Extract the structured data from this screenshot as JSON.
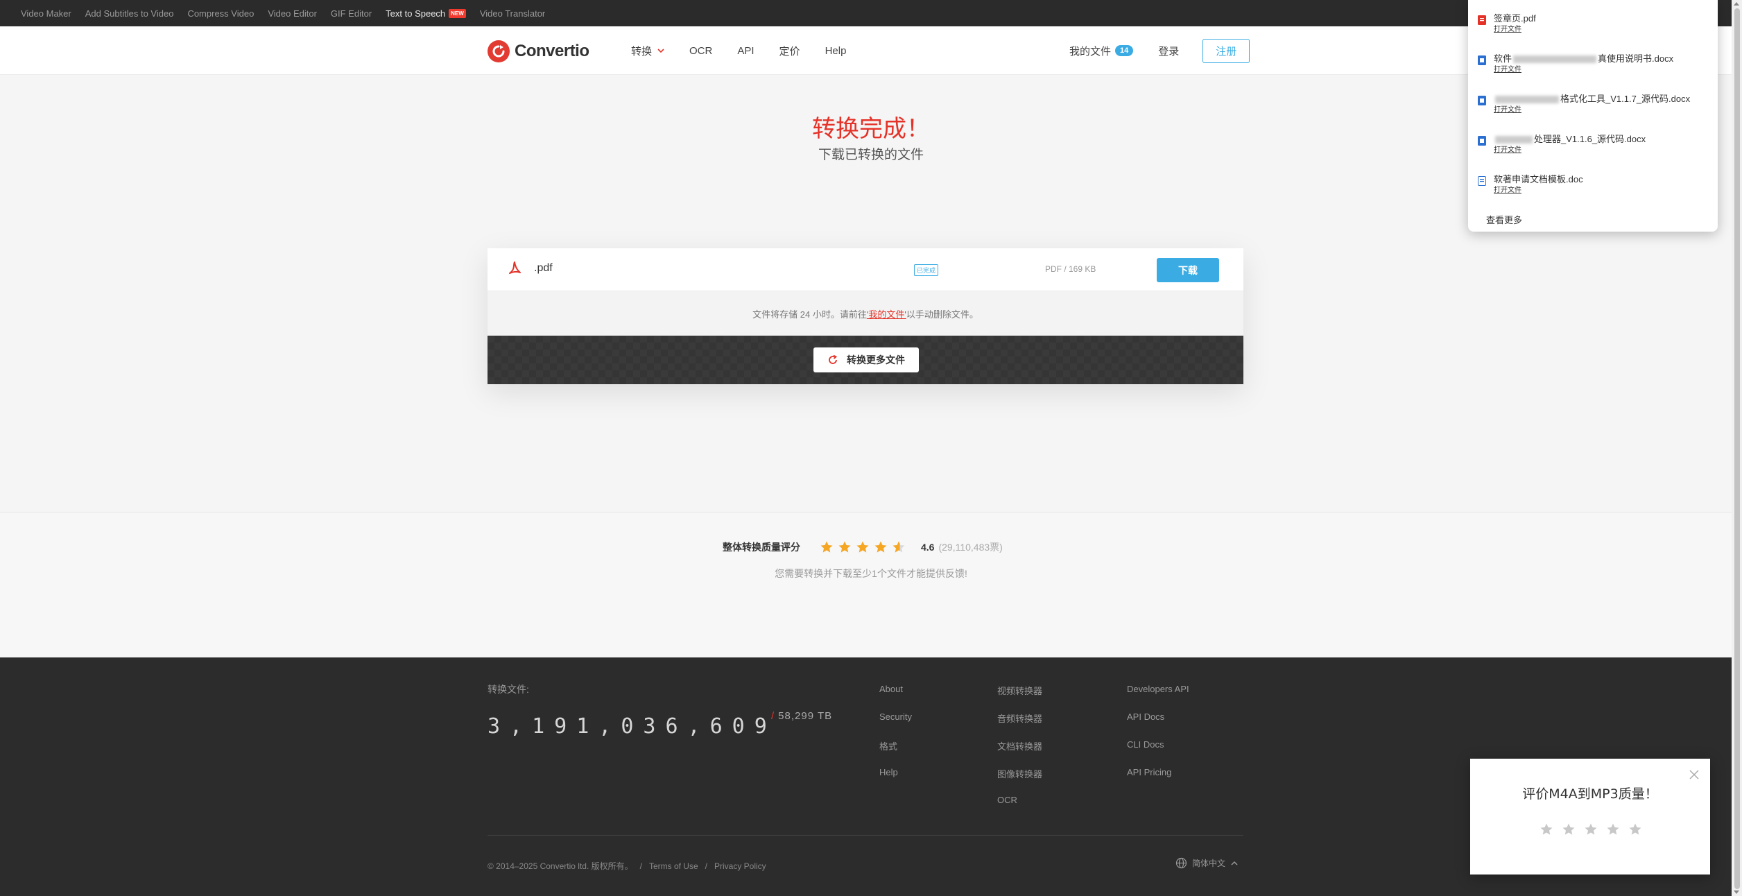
{
  "topbar": {
    "links": [
      "Video Maker",
      "Add Subtitles to Video",
      "Compress Video",
      "Video Editor",
      "GIF Editor",
      "Text to Speech",
      "Video Translator"
    ],
    "new_badge": "NEW"
  },
  "header": {
    "logo_text": "Convertio",
    "nav": [
      "转换",
      "OCR",
      "API",
      "定价",
      "Help"
    ],
    "my_files": "我的文件",
    "my_files_count": "14",
    "login": "登录",
    "signup": "注册"
  },
  "hero": {
    "title": "转换完成！",
    "subtitle": "下载已转换的文件"
  },
  "file": {
    "name": ".pdf",
    "status_tag": "已完成",
    "size": "PDF / 169 KB",
    "download": "下载"
  },
  "notice": {
    "prefix": "文件将存储 24 小时。请前往",
    "link": "'我的文件'",
    "suffix": "以手动删除文件。"
  },
  "convert_more": "转换更多文件",
  "rating": {
    "label": "整体转换质量评分",
    "stars": 4.6,
    "value": "4.6",
    "votes": "(29,110,483票)",
    "note": "您需要转换并下载至少1个文件才能提供反馈!"
  },
  "footer": {
    "converted_label": "转换文件:",
    "converted_count": "3,191,036,609",
    "converted_tb": "58,299 TB",
    "col1": [
      "About",
      "Security",
      "格式",
      "Help"
    ],
    "col2": [
      "视频转换器",
      "音频转换器",
      "文档转换器",
      "图像转换器",
      "OCR"
    ],
    "col3": [
      "Developers API",
      "API Docs",
      "CLI Docs",
      "API Pricing"
    ],
    "copyright": "© 2014–2025 Convertio ltd. 版权所有。",
    "terms": "Terms of Use",
    "privacy": "Privacy Policy",
    "language": "简体中文"
  },
  "recent_popup": {
    "items": [
      {
        "title": "签章页.pdf",
        "type": "pdf",
        "action": "打开文件"
      },
      {
        "title_pre": "软件",
        "title_post": "真使用说明书.docx",
        "type": "docx",
        "action": "打开文件"
      },
      {
        "title_pre": "",
        "title_post": "格式化工具_V1.1.7_源代码.docx",
        "type": "docx",
        "action": "打开文件"
      },
      {
        "title_pre": "",
        "title_post": "处理器_V1.1.6_源代码.docx",
        "type": "docx",
        "action": "打开文件"
      },
      {
        "title": "软著申请文档模板.doc",
        "type": "doc",
        "action": "打开文件"
      }
    ],
    "see_more": "查看更多"
  },
  "rate_widget": {
    "title": "评价M4A到MP3质量！",
    "stars_filled": 0
  },
  "colors": {
    "brand_red": "#e53228",
    "accent_blue": "#3aace3",
    "footer_bg": "#2c2c2c",
    "star_gold": "#f5a623"
  }
}
